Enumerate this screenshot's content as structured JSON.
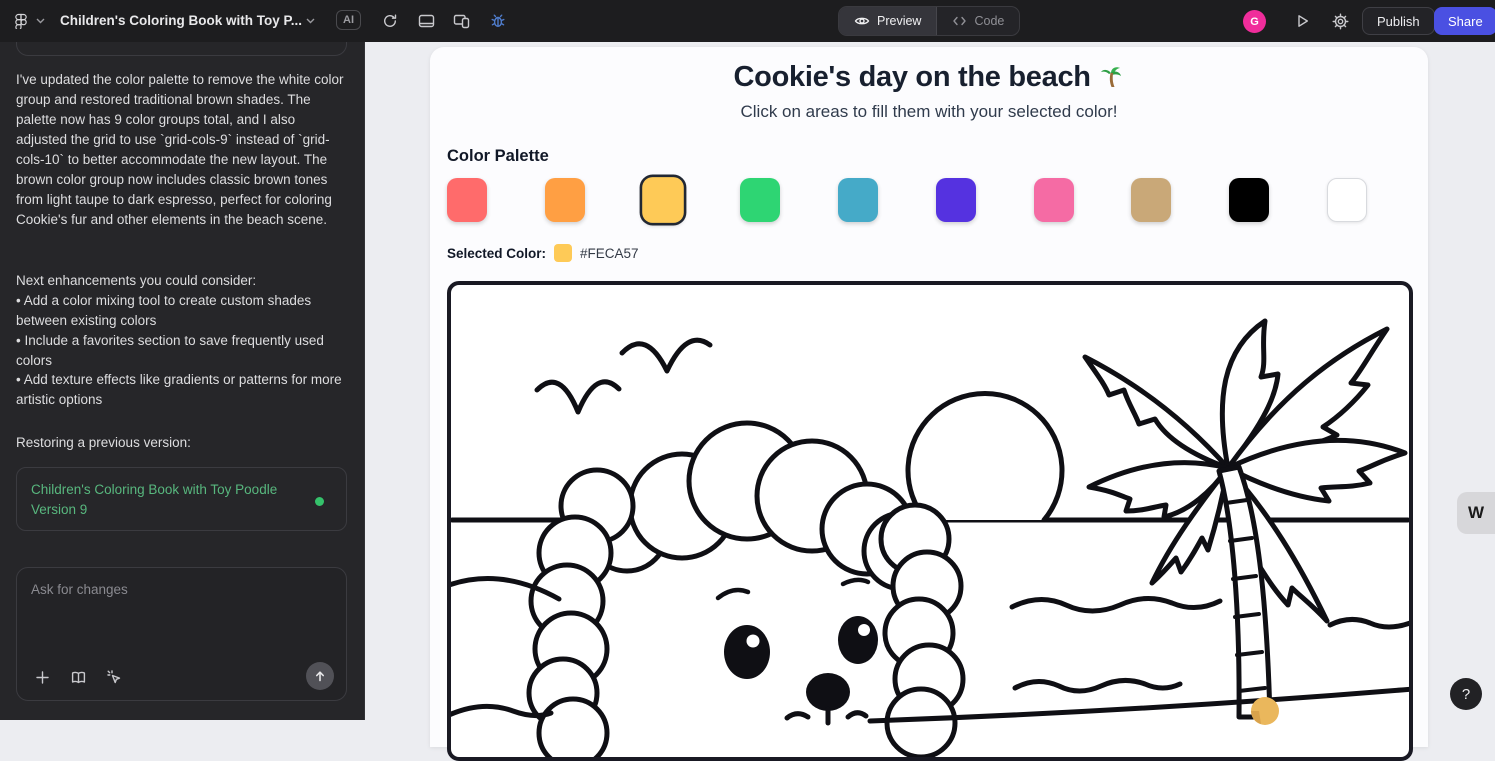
{
  "topbar": {
    "title": "Children's Coloring Book with Toy P...",
    "ai_badge": "AI",
    "preview_label": "Preview",
    "code_label": "Code",
    "publish_label": "Publish",
    "share_label": "Share",
    "avatar_initial": "G"
  },
  "sidebar": {
    "message_paragraph": "I've updated the color palette to remove the white color group and restored traditional brown shades. The palette now has 9 color groups total, and I also adjusted the grid to use `grid-cols-9` instead of `grid-cols-10` to better accommodate the new layout. The brown color group now includes classic brown tones from light taupe to dark espresso, perfect for coloring Cookie's fur and other elements in the beach scene.",
    "enhancements_intro": "Next enhancements you could consider:",
    "enhancements": [
      "• Add a color mixing tool to create custom shades between existing colors",
      "• Include a favorites section to save frequently used colors",
      "• Add texture effects like gradients or patterns for more artistic options"
    ],
    "restoring_label": "Restoring a previous version:",
    "version_card": {
      "title": "Children's Coloring Book with Toy Poodle",
      "subtitle": "Version 9"
    },
    "input_placeholder": "Ask for changes"
  },
  "app": {
    "title": "Cookie's day on the beach",
    "title_emoji": "🌴",
    "subtitle": "Click on areas to fill them with your selected color!",
    "palette_heading": "Color Palette",
    "swatches": [
      "#FF6B6B",
      "#FF9F43",
      "#FECA57",
      "#2ED573",
      "#45AAC8",
      "#5532E0",
      "#F56BA4",
      "#C9A878",
      "#000000",
      "#FFFFFF"
    ],
    "selected_index": 2,
    "selected_color_label": "Selected Color:",
    "selected_color_value": "#FECA57",
    "coconut_fill_color": "#EAB75C"
  },
  "floating": {
    "help_label": "?",
    "w_badge": "W"
  },
  "colors": {
    "share_button": "#4A50E2",
    "avatar": "#F02D9B",
    "version_link": "#58B77E",
    "bug_icon": "#4F7CCB",
    "selected_ring": "#222833"
  }
}
